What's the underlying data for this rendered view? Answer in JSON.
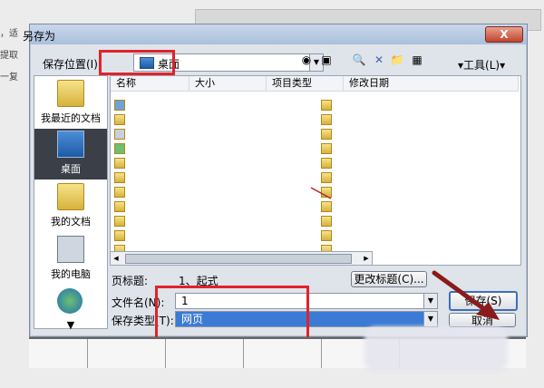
{
  "dialog": {
    "title": "另存为",
    "close_label": "X"
  },
  "location": {
    "label": "保存位置(I):",
    "value": "桌面"
  },
  "toolbar": {
    "tools_label": "工具(L)"
  },
  "places": [
    {
      "label": "我最近的文档",
      "icon": "recent-folder-icon"
    },
    {
      "label": "桌面",
      "icon": "desktop-icon",
      "selected": true
    },
    {
      "label": "我的文档",
      "icon": "my-documents-icon"
    },
    {
      "label": "我的电脑",
      "icon": "my-computer-icon"
    },
    {
      "label": "",
      "icon": "network-globe-icon"
    }
  ],
  "file_list": {
    "columns": [
      "名称",
      "大小",
      "项目类型",
      "修改日期"
    ]
  },
  "page_title": {
    "label": "页标题:",
    "value": "1、起式",
    "change_button": "更改标题(C)..."
  },
  "filename": {
    "label": "文件名(N):",
    "value": "1"
  },
  "filetype": {
    "label": "保存类型(T):",
    "value": "网页"
  },
  "buttons": {
    "save": "保存(S)",
    "cancel": "取消"
  },
  "background": {
    "text_a": "，适",
    "text_b": "提取",
    "text_c": "一复"
  },
  "colors": {
    "highlight_red": "#e0232a",
    "selection_blue": "#3b7bd6"
  }
}
